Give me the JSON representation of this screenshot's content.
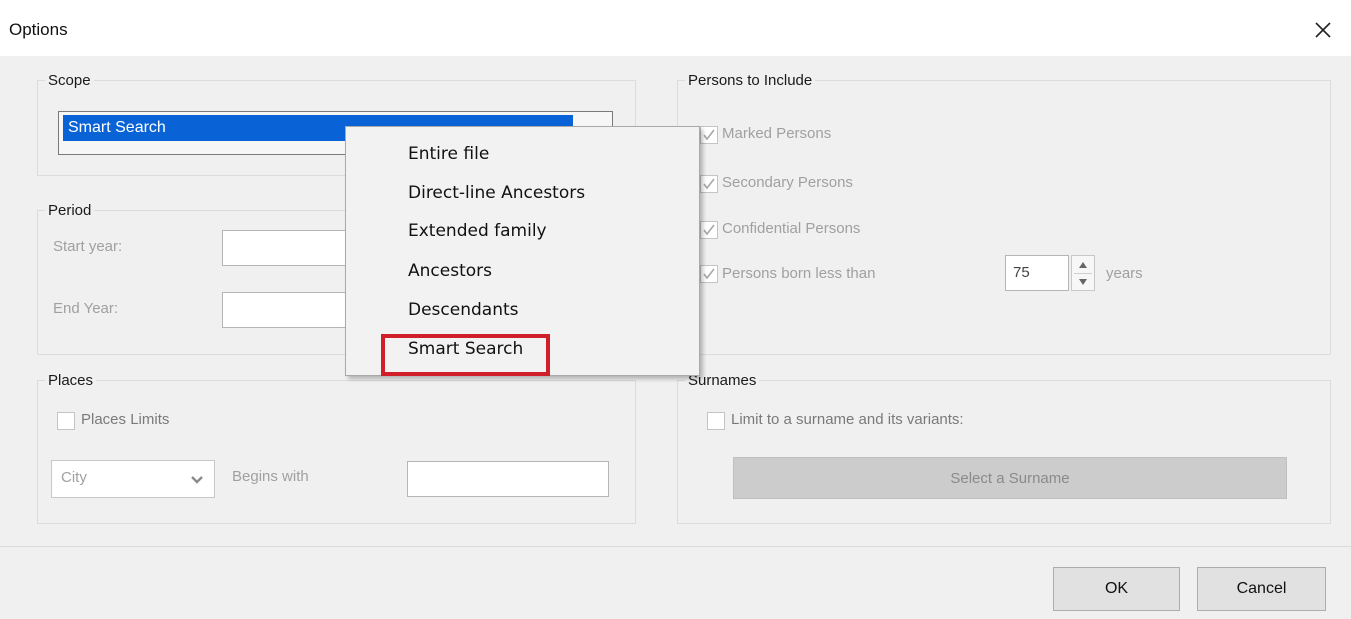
{
  "window": {
    "title": "Options",
    "close_glyph": "✕"
  },
  "scope": {
    "legend": "Scope",
    "selected": "Smart Search"
  },
  "period": {
    "legend": "Period",
    "start_label": "Start year:",
    "end_label": "End Year:",
    "start_value": "",
    "end_value": ""
  },
  "places": {
    "legend": "Places",
    "limits_label": "Places Limits",
    "limits_checked": false,
    "city_value": "City",
    "begins_label": "Begins with",
    "begins_value": ""
  },
  "persons": {
    "legend": "Persons to Include",
    "marked_label": "Marked Persons",
    "secondary_label": "Secondary Persons",
    "confidential_label": "Confidential Persons",
    "born_label": "Persons born less than",
    "born_value": "75",
    "years_label": "years"
  },
  "surnames": {
    "legend": "Surnames",
    "limit_label": "Limit to a surname and its variants:",
    "select_button": "Select a Surname"
  },
  "buttons": {
    "ok": "OK",
    "cancel": "Cancel"
  },
  "menu": {
    "items": [
      "Entire file",
      "Direct-line Ancestors",
      "Extended family",
      "Ancestors",
      "Descendants",
      "Smart Search"
    ],
    "highlighted": "Smart Search"
  },
  "colors": {
    "selection_blue": "#0a63d6",
    "highlight_red": "#d11f2a",
    "dialog_bg": "#f0f0f0"
  },
  "icons": {
    "close": "close-icon",
    "dropdown": "chevron-down-icon",
    "spin_up": "spin-up-icon",
    "spin_down": "spin-down-icon",
    "check": "checkmark-icon"
  }
}
